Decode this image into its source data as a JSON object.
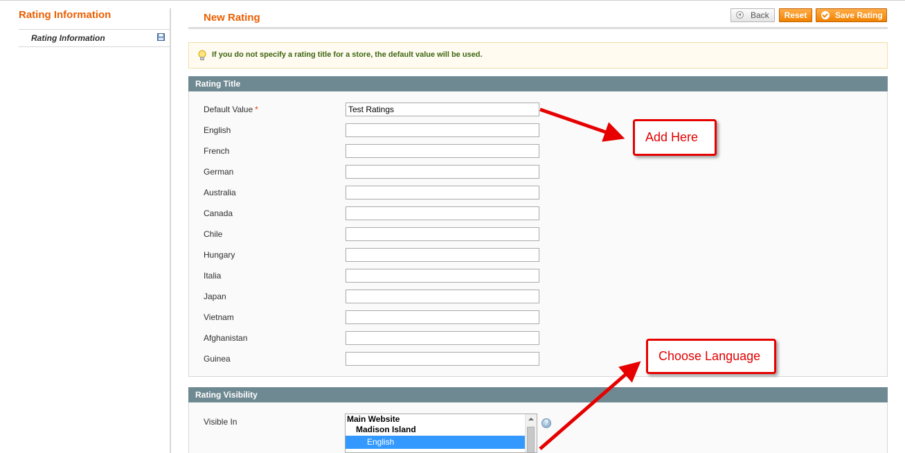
{
  "sidebar": {
    "title": "Rating Information",
    "items": [
      {
        "label": "Rating Information",
        "icon": "save-icon"
      }
    ]
  },
  "header": {
    "title": "New Rating",
    "buttons": {
      "back": "Back",
      "reset": "Reset",
      "save": "Save Rating"
    }
  },
  "notice": {
    "text": "If you do not specify a rating title for a store, the default value will be used.",
    "icon": "lightbulb-icon"
  },
  "rating_title": {
    "heading": "Rating Title",
    "fields": [
      {
        "label": "Default Value",
        "value": "Test Ratings",
        "required": "*"
      },
      {
        "label": "English",
        "value": ""
      },
      {
        "label": "French",
        "value": ""
      },
      {
        "label": "German",
        "value": ""
      },
      {
        "label": "Australia",
        "value": ""
      },
      {
        "label": "Canada",
        "value": ""
      },
      {
        "label": "Chile",
        "value": ""
      },
      {
        "label": "Hungary",
        "value": ""
      },
      {
        "label": "Italia",
        "value": ""
      },
      {
        "label": "Japan",
        "value": ""
      },
      {
        "label": "Vietnam",
        "value": ""
      },
      {
        "label": "Afghanistan",
        "value": ""
      },
      {
        "label": "Guinea",
        "value": ""
      }
    ]
  },
  "rating_visibility": {
    "heading": "Rating Visibility",
    "label": "Visible In",
    "options": [
      {
        "label": "Main Website",
        "level": 0,
        "selected": false
      },
      {
        "label": "Madison Island",
        "level": 1,
        "selected": false
      },
      {
        "label": "English",
        "level": 2,
        "selected": true
      }
    ]
  },
  "annotations": {
    "add_here": "Add Here",
    "choose_language": "Choose Language"
  },
  "colors": {
    "accent": "#eb5e00",
    "section_header": "#6f8992",
    "annotation": "#e60000",
    "selected": "#3399ff"
  }
}
